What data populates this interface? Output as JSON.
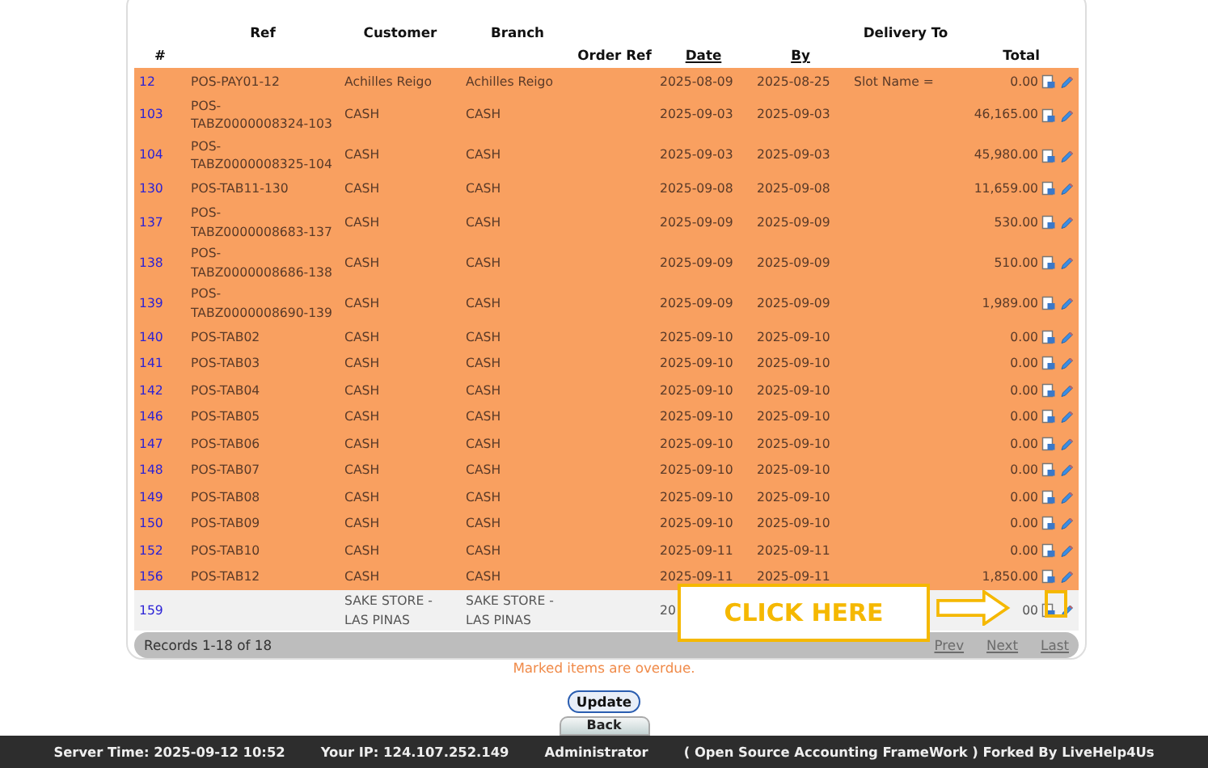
{
  "table": {
    "columns": [
      "#",
      "Ref",
      "Customer",
      "Branch",
      "Order Ref",
      "Date",
      "By",
      "Delivery To",
      "Total"
    ],
    "rows": [
      {
        "id": "12",
        "ref": "POS-PAY01-12",
        "customer": "Achilles Reigo",
        "branch": "Achilles Reigo",
        "order_ref": "",
        "order_date": "2025-08-09",
        "required_by": "2025-08-25",
        "delivery_to": "Slot Name =",
        "total": "0.00",
        "overdue": true
      },
      {
        "id": "103",
        "ref": "POS-TABZ0000008324-103",
        "customer": "CASH",
        "branch": "CASH",
        "order_ref": "",
        "order_date": "2025-09-03",
        "required_by": "2025-09-03",
        "delivery_to": "",
        "total": "46,165.00",
        "overdue": true
      },
      {
        "id": "104",
        "ref": "POS-TABZ0000008325-104",
        "customer": "CASH",
        "branch": "CASH",
        "order_ref": "",
        "order_date": "2025-09-03",
        "required_by": "2025-09-03",
        "delivery_to": "",
        "total": "45,980.00",
        "overdue": true
      },
      {
        "id": "130",
        "ref": "POS-TAB11-130",
        "customer": "CASH",
        "branch": "CASH",
        "order_ref": "",
        "order_date": "2025-09-08",
        "required_by": "2025-09-08",
        "delivery_to": "",
        "total": "11,659.00",
        "overdue": true
      },
      {
        "id": "137",
        "ref": "POS-TABZ0000008683-137",
        "customer": "CASH",
        "branch": "CASH",
        "order_ref": "",
        "order_date": "2025-09-09",
        "required_by": "2025-09-09",
        "delivery_to": "",
        "total": "530.00",
        "overdue": true
      },
      {
        "id": "138",
        "ref": "POS-TABZ0000008686-138",
        "customer": "CASH",
        "branch": "CASH",
        "order_ref": "",
        "order_date": "2025-09-09",
        "required_by": "2025-09-09",
        "delivery_to": "",
        "total": "510.00",
        "overdue": true
      },
      {
        "id": "139",
        "ref": "POS-TABZ0000008690-139",
        "customer": "CASH",
        "branch": "CASH",
        "order_ref": "",
        "order_date": "2025-09-09",
        "required_by": "2025-09-09",
        "delivery_to": "",
        "total": "1,989.00",
        "overdue": true
      },
      {
        "id": "140",
        "ref": "POS-TAB02",
        "customer": "CASH",
        "branch": "CASH",
        "order_ref": "",
        "order_date": "2025-09-10",
        "required_by": "2025-09-10",
        "delivery_to": "",
        "total": "0.00",
        "overdue": true
      },
      {
        "id": "141",
        "ref": "POS-TAB03",
        "customer": "CASH",
        "branch": "CASH",
        "order_ref": "",
        "order_date": "2025-09-10",
        "required_by": "2025-09-10",
        "delivery_to": "",
        "total": "0.00",
        "overdue": true
      },
      {
        "id": "142",
        "ref": "POS-TAB04",
        "customer": "CASH",
        "branch": "CASH",
        "order_ref": "",
        "order_date": "2025-09-10",
        "required_by": "2025-09-10",
        "delivery_to": "",
        "total": "0.00",
        "overdue": true
      },
      {
        "id": "146",
        "ref": "POS-TAB05",
        "customer": "CASH",
        "branch": "CASH",
        "order_ref": "",
        "order_date": "2025-09-10",
        "required_by": "2025-09-10",
        "delivery_to": "",
        "total": "0.00",
        "overdue": true
      },
      {
        "id": "147",
        "ref": "POS-TAB06",
        "customer": "CASH",
        "branch": "CASH",
        "order_ref": "",
        "order_date": "2025-09-10",
        "required_by": "2025-09-10",
        "delivery_to": "",
        "total": "0.00",
        "overdue": true
      },
      {
        "id": "148",
        "ref": "POS-TAB07",
        "customer": "CASH",
        "branch": "CASH",
        "order_ref": "",
        "order_date": "2025-09-10",
        "required_by": "2025-09-10",
        "delivery_to": "",
        "total": "0.00",
        "overdue": true
      },
      {
        "id": "149",
        "ref": "POS-TAB08",
        "customer": "CASH",
        "branch": "CASH",
        "order_ref": "",
        "order_date": "2025-09-10",
        "required_by": "2025-09-10",
        "delivery_to": "",
        "total": "0.00",
        "overdue": true
      },
      {
        "id": "150",
        "ref": "POS-TAB09",
        "customer": "CASH",
        "branch": "CASH",
        "order_ref": "",
        "order_date": "2025-09-10",
        "required_by": "2025-09-10",
        "delivery_to": "",
        "total": "0.00",
        "overdue": true
      },
      {
        "id": "152",
        "ref": "POS-TAB10",
        "customer": "CASH",
        "branch": "CASH",
        "order_ref": "",
        "order_date": "2025-09-11",
        "required_by": "2025-09-11",
        "delivery_to": "",
        "total": "0.00",
        "overdue": true
      },
      {
        "id": "156",
        "ref": "POS-TAB12",
        "customer": "CASH",
        "branch": "CASH",
        "order_ref": "",
        "order_date": "2025-09-11",
        "required_by": "2025-09-11",
        "delivery_to": "",
        "total": "1,850.00",
        "overdue": true
      },
      {
        "id": "159",
        "ref": "",
        "customer": "SAKE STORE - LAS PINAS",
        "branch": "SAKE STORE - LAS PINAS",
        "order_ref": "",
        "order_date": "20",
        "required_by": "",
        "delivery_to": "",
        "total": "00",
        "overdue": false
      }
    ]
  },
  "pagination": {
    "records": "Records 1-18 of 18",
    "links": [
      {
        "label": "Prev",
        "disabled": true
      },
      {
        "label": "Next",
        "disabled": true
      },
      {
        "label": "Last",
        "disabled": true
      }
    ]
  },
  "callout": {
    "text": "CLICK HERE"
  },
  "note": "Marked items are overdue.",
  "buttons": [
    {
      "label": "Update"
    },
    {
      "label": "Back"
    }
  ],
  "status_bar": [
    "Server Time: 2025-09-12 10:52",
    "Your IP: 124.107.252.149",
    "Administrator",
    "( Open Source Accounting FrameWork ) Forked By LiveHelp4Us"
  ]
}
